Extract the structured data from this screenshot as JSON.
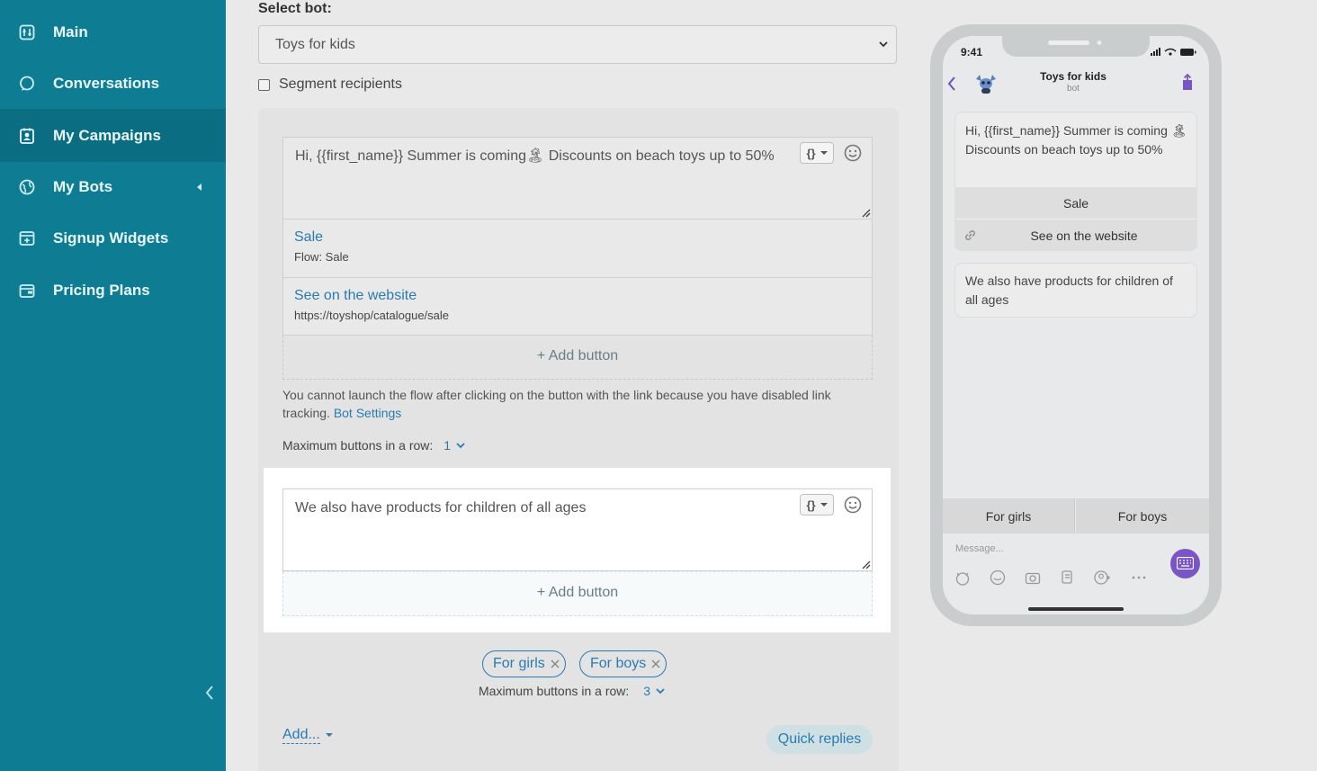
{
  "sidebar": {
    "items": [
      {
        "label": "Main",
        "icon": "dashboard-icon"
      },
      {
        "label": "Conversations",
        "icon": "chat-bubble-icon"
      },
      {
        "label": "My Campaigns",
        "icon": "campaign-icon",
        "active": true
      },
      {
        "label": "My Bots",
        "icon": "bot-globe-icon"
      },
      {
        "label": "Signup Widgets",
        "icon": "widget-icon"
      },
      {
        "label": "Pricing Plans",
        "icon": "wallet-icon"
      }
    ]
  },
  "form": {
    "select_label": "Select bot:",
    "selected_bot": "Toys for kids",
    "segment_label": "Segment recipients",
    "message1": {
      "text": "Hi,  {{first_name}} Summer is coming🏝 Discounts on beach toys up to 50%",
      "buttons": [
        {
          "title": "Sale",
          "subtitle": "Flow: Sale"
        },
        {
          "title": "See on the website",
          "subtitle": "https://toyshop/catalogue/sale"
        }
      ],
      "add_button": "+ Add button"
    },
    "note": "You cannot launch the flow after clicking on the button with the link because you have disabled link tracking.",
    "note_link": "Bot Settings",
    "max_row_label": "Maximum buttons in a row:",
    "max_row_value_1": "1",
    "message2": {
      "text": "We also have products for children of all ages",
      "add_button": "+ Add button"
    },
    "quick_replies": [
      "For girls",
      "For boys"
    ],
    "max_row_value_2": "3",
    "add_menu": "Add...",
    "quick_replies_button": "Quick replies"
  },
  "phone": {
    "time": "9:41",
    "title": "Toys for kids",
    "subtitle": "bot",
    "bubble1_text": "Hi,  {{first_name}} Summer is coming 🏝 Discounts on beach toys up to 50%",
    "bubble1_buttons": [
      "Sale",
      "See on the website"
    ],
    "bubble2_text": "We also have products for children of all ages",
    "quick_replies": [
      "For girls",
      "For boys"
    ],
    "message_placeholder": "Message..."
  },
  "colors": {
    "sidebar": "#0e7d94",
    "accent": "#2a7bb0",
    "phone_accent": "#7a55c7"
  }
}
